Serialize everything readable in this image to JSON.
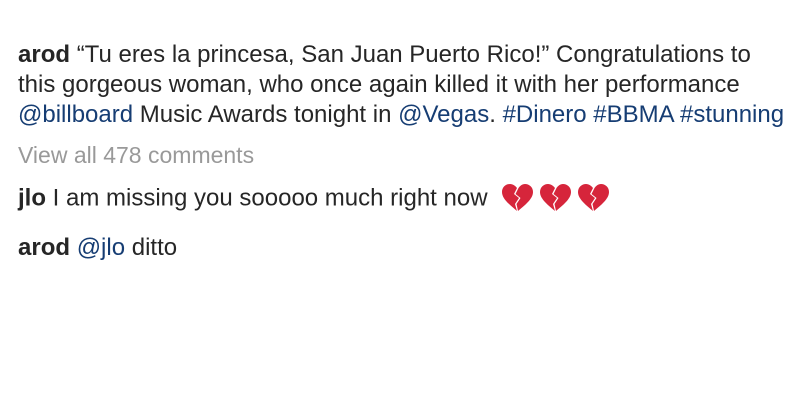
{
  "post": {
    "author": "arod",
    "caption_parts": {
      "t1": "“Tu eres la princesa, San Juan Puerto Rico!” Congratulations to this gorgeous woman, who once again killed it with her performance ",
      "mention_billboard": "@billboard",
      "t2": " Music Awards tonight in ",
      "mention_vegas": "@Vegas",
      "t3": ". ",
      "hashtag_dinero": "#Dinero",
      "hashtag_bbma": "#BBMA",
      "hashtag_stunning": "#stunning"
    },
    "view_all_comments": "View all 478 comments"
  },
  "comments": [
    {
      "author": "jlo",
      "text": "I am missing you sooooo much right now",
      "emojis": [
        "broken-heart",
        "broken-heart",
        "broken-heart"
      ]
    },
    {
      "author": "arod",
      "mention": "@jlo",
      "text": "ditto"
    }
  ],
  "colors": {
    "text": "#262626",
    "link": "#163d73",
    "muted": "#999999",
    "heart": "#d6253b"
  }
}
